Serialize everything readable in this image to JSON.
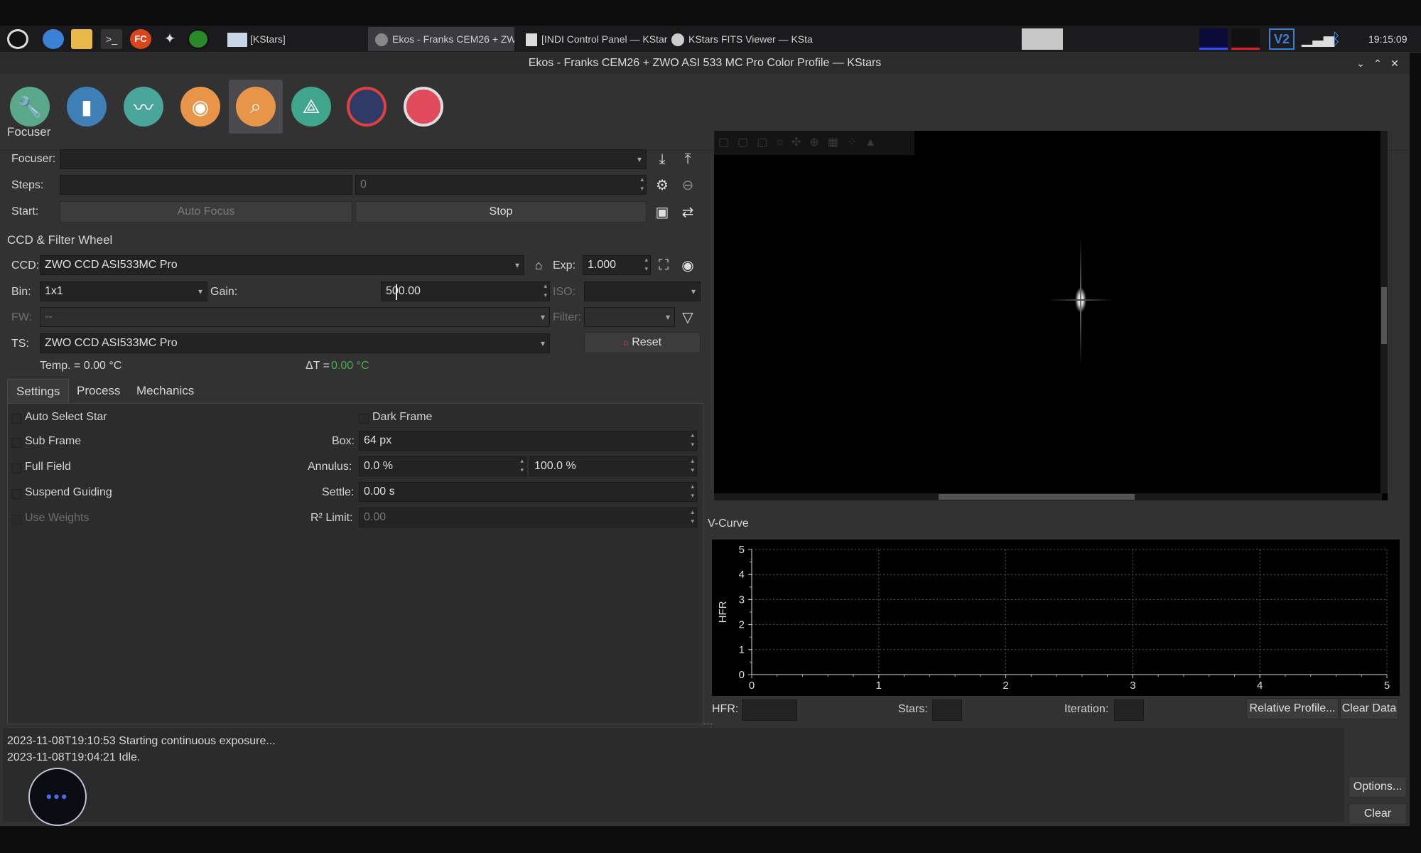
{
  "taskbar": {
    "tasks": [
      {
        "label": "[KStars]"
      },
      {
        "label": "Ekos - Franks CEM26 + ZW..."
      },
      {
        "label": "[INDI Control Panel — KStar..."
      },
      {
        "label": "KStars FITS Viewer — KSta..."
      }
    ],
    "clock": "19:15:09"
  },
  "window": {
    "title": "Ekos - Franks CEM26 + ZWO ASI 533 MC Pro Color Profile — KStars"
  },
  "focuser": {
    "section": "Focuser",
    "focuser_label": "Focuser:",
    "steps_label": "Steps:",
    "steps_value": "0",
    "start_label": "Start:",
    "auto_focus": "Auto Focus",
    "stop": "Stop"
  },
  "ccd": {
    "section": "CCD & Filter Wheel",
    "ccd_label": "CCD:",
    "ccd_value": "ZWO CCD ASI533MC Pro",
    "exp_label": "Exp:",
    "exp_value": "1.000",
    "bin_label": "Bin:",
    "bin_value": "1x1",
    "gain_label": "Gain:",
    "gain_value": "500.00",
    "iso_label": "ISO:",
    "fw_label": "FW:",
    "fw_value": "--",
    "filter_label": "Filter:",
    "ts_label": "TS:",
    "ts_value": "ZWO CCD ASI533MC Pro",
    "reset": "Reset",
    "temp": "Temp. = 0.00 °C",
    "dt_label": "ΔT =",
    "dt_value": "0.00 °C"
  },
  "tabs": [
    "Settings",
    "Process",
    "Mechanics"
  ],
  "settings": {
    "auto_select_star": "Auto Select Star",
    "sub_frame": "Sub Frame",
    "full_field": "Full Field",
    "suspend_guiding": "Suspend Guiding",
    "use_weights": "Use Weights",
    "dark_frame": "Dark Frame",
    "box_label": "Box:",
    "box_value": "64 px",
    "annulus_label": "Annulus:",
    "annulus_min": "0.0 %",
    "annulus_max": "100.0 %",
    "settle_label": "Settle:",
    "settle_value": "0.00 s",
    "r2_label": "R² Limit:",
    "r2_value": "0.00"
  },
  "vcurve": {
    "section": "V-Curve",
    "hfr_label": "HFR:",
    "stars_label": "Stars:",
    "iteration_label": "Iteration:",
    "relative_profile": "Relative Profile...",
    "clear_data": "Clear Data"
  },
  "chart_data": {
    "type": "line",
    "title": "",
    "xlabel": "",
    "ylabel": "HFR",
    "xlim": [
      0,
      5
    ],
    "ylim": [
      0,
      5
    ],
    "x_ticks": [
      "0",
      "1",
      "2",
      "3",
      "4",
      "5"
    ],
    "y_ticks": [
      "0",
      "1",
      "2",
      "3",
      "4",
      "5"
    ],
    "grid": true,
    "series": []
  },
  "log": {
    "lines": [
      "2023-11-08T19:10:53 Starting continuous exposure...",
      "2023-11-08T19:04:21 Idle."
    ],
    "options": "Options...",
    "clear": "Clear"
  },
  "colors": {
    "accent": "#4caf50",
    "background": "#323232"
  }
}
